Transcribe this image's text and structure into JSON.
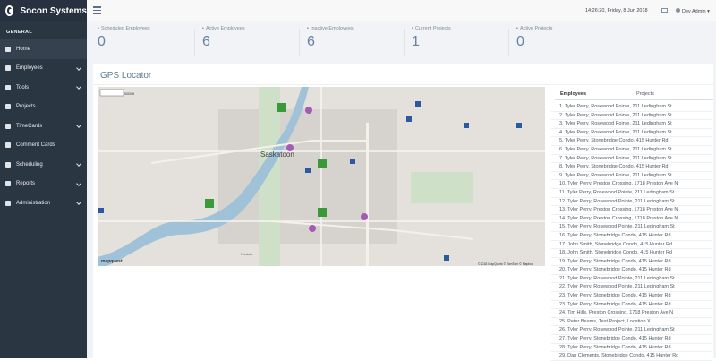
{
  "app": {
    "name": "Socon Systems"
  },
  "sidebar": {
    "section": "GENERAL",
    "items": [
      {
        "label": "Home",
        "icon": "home-icon",
        "active": true
      },
      {
        "label": "Employees",
        "icon": "users-icon",
        "chevron": true
      },
      {
        "label": "Tools",
        "icon": "wrench-icon",
        "chevron": true
      },
      {
        "label": "Projects",
        "icon": "folder-icon"
      },
      {
        "label": "TimeCards",
        "icon": "clock-icon",
        "chevron": true
      },
      {
        "label": "Comment Cards",
        "icon": "comment-icon"
      },
      {
        "label": "Scheduling",
        "icon": "calendar-icon",
        "chevron": true
      },
      {
        "label": "Reports",
        "icon": "file-icon",
        "chevron": true
      },
      {
        "label": "Administration",
        "icon": "gear-icon",
        "chevron": true
      }
    ]
  },
  "topbar": {
    "datetime": "14:26:20, Friday, 8 Jun 2018",
    "user": "Dev Admin"
  },
  "stats": [
    {
      "label": "Scheduled Employees",
      "value": "0"
    },
    {
      "label": "Active Employees",
      "value": "6"
    },
    {
      "label": "Inactive Employees",
      "value": "6"
    },
    {
      "label": "Current Projects",
      "value": "1"
    },
    {
      "label": "Active Projects",
      "value": "0"
    }
  ],
  "gps": {
    "title": "GPS Locator",
    "map_city": "Saskatoon",
    "map_credit": "©2018 MapQuest © TomTom © Mapbox",
    "map_logo": "mapquest",
    "scale_label": "5000 ft",
    "place_label": "Furdale"
  },
  "tabs": {
    "employees": "Employees",
    "projects": "Projects"
  },
  "locations": [
    "1. Tyler Perry, Rosewood Pointe, 211 Ledingham St",
    "2. Tyler Perry, Rosewood Pointe, 211 Ledingham St",
    "3. Tyler Perry, Rosewood Pointe, 211 Ledingham St",
    "4. Tyler Perry, Rosewood Pointe, 211 Ledingham St",
    "5. Tyler Perry, Stonebridge Condo, 415 Hunter Rd",
    "6. Tyler Perry, Rosewood Pointe, 211 Ledingham St",
    "7. Tyler Perry, Rosewood Pointe, 211 Ledingham St",
    "8. Tyler Perry, Stonebridge Condo, 415 Hunter Rd",
    "9. Tyler Perry, Rosewood Pointe, 211 Ledingham St",
    "10. Tyler Perry, Preston Crossing, 1718 Preston Ave N",
    "11. Tyler Perry, Rosewood Pointe, 211 Ledingham St",
    "12. Tyler Perry, Rosewood Pointe, 211 Ledingham St",
    "13. Tyler Perry, Preston Crossing, 1718 Preston Ave N",
    "14. Tyler Perry, Preston Crossing, 1718 Preston Ave N",
    "15. Tyler Perry, Rosewood Pointe, 211 Ledingham St",
    "16. Tyler Perry, Stonebridge Condo, 415 Hunter Rd",
    "17. John Smith, Stonebridge Condo, 415 Hunter Rd",
    "18. John Smith, Stonebridge Condo, 415 Hunter Rd",
    "19. Tyler Perry, Stonebridge Condo, 415 Hunter Rd",
    "20. Tyler Perry, Stonebridge Condo, 415 Hunter Rd",
    "21. Tyler Perry, Rosewood Pointe, 211 Ledingham St",
    "22. Tyler Perry, Rosewood Pointe, 211 Ledingham St",
    "23. Tyler Perry, Stonebridge Condo, 415 Hunter Rd",
    "23. Tyler Perry, Stonebridge Condo, 415 Hunter Rd",
    "24. Tim Hills, Preston Crossing, 1718 Preston Ave N",
    "25. Peter Beams, Test Project, Location X",
    "26. Tyler Perry, Rosewood Pointe, 211 Ledingham St",
    "27. Tyler Perry, Stonebridge Condo, 415 Hunter Rd",
    "28. Tyler Perry, Stonebridge Condo, 415 Hunter Rd",
    "29. Dan Clements, Stonebridge Condo, 415 Hunter Rd"
  ]
}
